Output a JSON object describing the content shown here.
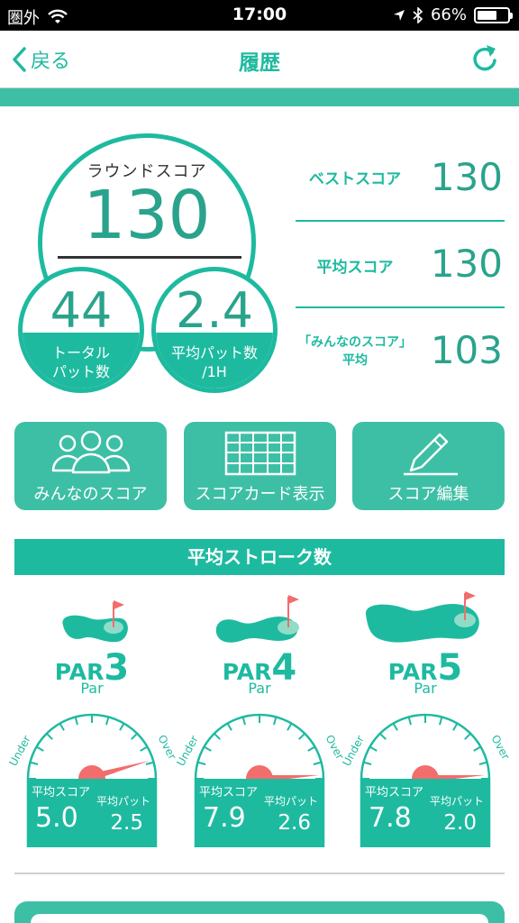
{
  "status_bar": {
    "carrier": "圏外",
    "time": "17:00",
    "battery": "66%",
    "battery_level": 0.66
  },
  "nav": {
    "back_label": "戻る",
    "title": "履歴"
  },
  "round": {
    "label": "ラウンドスコア",
    "score": "130"
  },
  "total_putts": {
    "value": "44",
    "label_line1": "トータル",
    "label_line2": "パット数"
  },
  "avg_putts": {
    "value": "2.4",
    "label_line1": "平均パット数",
    "label_line2": "/1H"
  },
  "stats": [
    {
      "label": "ベストスコア",
      "value": "130"
    },
    {
      "label": "平均スコア",
      "value": "130"
    },
    {
      "label_line1": "「みんなのスコア」",
      "label_line2": "平均",
      "value": "103"
    }
  ],
  "actions": [
    {
      "label": "みんなのスコア",
      "icon": "people-icon"
    },
    {
      "label": "スコアカード表示",
      "icon": "scorecard-grid-icon"
    },
    {
      "label": "スコア編集",
      "icon": "pencil-icon"
    }
  ],
  "section_title": "平均ストローク数",
  "gauge_labels": {
    "par": "Par",
    "under": "Under",
    "over": "Over",
    "avg_score": "平均スコア",
    "avg_putt": "平均パット"
  },
  "pars": [
    {
      "par_text": "PAR",
      "number": "3",
      "avg_score": "5.0",
      "avg_putt": "2.5"
    },
    {
      "par_text": "PAR",
      "number": "4",
      "avg_score": "7.9",
      "avg_putt": "2.6"
    },
    {
      "par_text": "PAR",
      "number": "5",
      "avg_score": "7.8",
      "avg_putt": "2.0"
    }
  ],
  "colors": {
    "teal": "#1ebaa0",
    "teal_light": "#3dbfa5",
    "needle": "#f26d6d",
    "flag": "#f26d6d",
    "green": "#8fdcc8"
  }
}
